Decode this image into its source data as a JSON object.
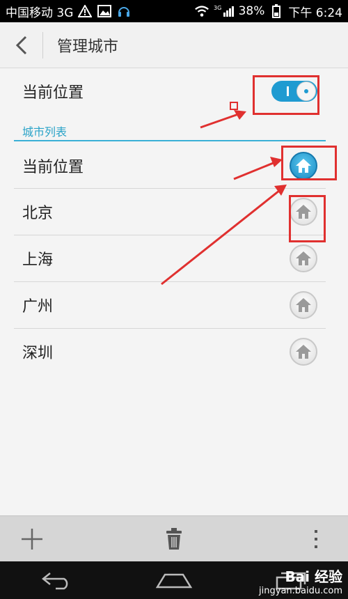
{
  "status_bar": {
    "carrier": "中国移动 3G",
    "signal_label": "3G",
    "battery": "38%",
    "time": "下午 6:24"
  },
  "header": {
    "title": "管理城市"
  },
  "current_location": {
    "label": "当前位置",
    "toggle_on": true
  },
  "section": {
    "title": "城市列表"
  },
  "cities": [
    {
      "name": "当前位置",
      "is_home": true
    },
    {
      "name": "北京",
      "is_home": false
    },
    {
      "name": "上海",
      "is_home": false
    },
    {
      "name": "广州",
      "is_home": false
    },
    {
      "name": "深圳",
      "is_home": false
    }
  ],
  "colors": {
    "accent": "#1f9bd1",
    "annotation": "#e0302f"
  },
  "toolbar": {
    "add_icon": "plus-icon",
    "delete_icon": "trash-icon",
    "menu_icon": "more-vert-icon"
  },
  "watermark": {
    "brand": "Bai 经验",
    "url": "jingyan.baidu.com"
  }
}
